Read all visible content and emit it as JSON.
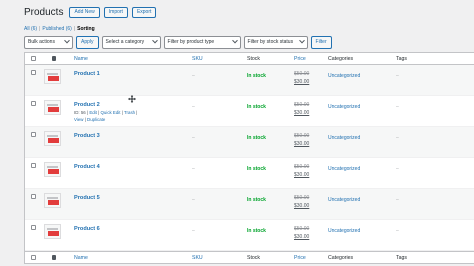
{
  "header": {
    "title": "Products",
    "buttons": [
      "Add New",
      "Import",
      "Export"
    ]
  },
  "views": {
    "all": "All (6)",
    "published": "Published (6)",
    "sorting": "Sorting"
  },
  "filters": {
    "bulk_actions": "Bulk actions",
    "apply": "Apply",
    "category": "Select a category",
    "product_type": "Filter by product type",
    "stock_status": "Filter by stock status",
    "filter": "Filter"
  },
  "columns": {
    "name": "Name",
    "sku": "SKU",
    "stock": "Stock",
    "price": "Price",
    "categories": "Categories",
    "tags": "Tags"
  },
  "row_actions": {
    "id": "ID: 56",
    "edit": "Edit",
    "quick_edit": "Quick Edit",
    "trash": "Trash",
    "view": "View",
    "duplicate": "Duplicate"
  },
  "products": [
    {
      "name": "Product 1",
      "sku": "–",
      "stock": "In stock",
      "old_price": "$50.00",
      "new_price": "$30.00",
      "category": "Uncategorized",
      "tags": "–"
    },
    {
      "name": "Product 2",
      "sku": "–",
      "stock": "In stock",
      "old_price": "$50.00",
      "new_price": "$30.00",
      "category": "Uncategorized",
      "tags": "–"
    },
    {
      "name": "Product 3",
      "sku": "–",
      "stock": "In stock",
      "old_price": "$50.00",
      "new_price": "$30.00",
      "category": "Uncategorized",
      "tags": "–"
    },
    {
      "name": "Product 4",
      "sku": "–",
      "stock": "In stock",
      "old_price": "$50.00",
      "new_price": "$30.00",
      "category": "Uncategorized",
      "tags": "–"
    },
    {
      "name": "Product 5",
      "sku": "–",
      "stock": "In stock",
      "old_price": "$50.00",
      "new_price": "$30.00",
      "category": "Uncategorized",
      "tags": "–"
    },
    {
      "name": "Product 6",
      "sku": "–",
      "stock": "In stock",
      "old_price": "$50.00",
      "new_price": "$30.00",
      "category": "Uncategorized",
      "tags": "–"
    }
  ],
  "colors": {
    "link": "#2271b1",
    "in_stock": "#00a32a",
    "thumb_accent": "#e23c3c"
  }
}
